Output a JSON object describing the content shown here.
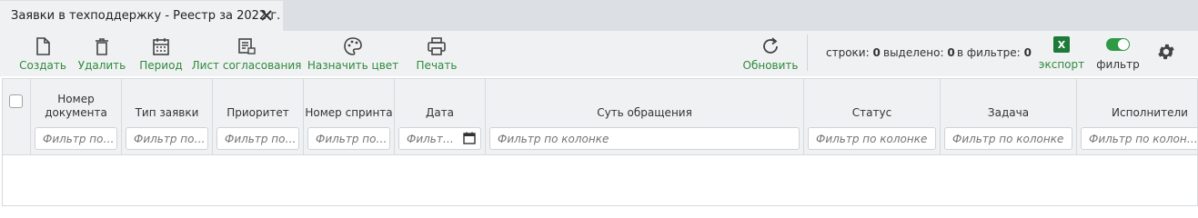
{
  "tab": {
    "title": "Заявки в техподдержку - Реестр за 2022 г.",
    "close_icon": "close-icon"
  },
  "toolbar": {
    "create": "Создать",
    "delete": "Удалить",
    "period": "Период",
    "approval": "Лист согласования",
    "color": "Назначить цвет",
    "print": "Печать",
    "refresh": "Обновить",
    "export": "экспорт",
    "filter": "фильтр",
    "export_icon_letter": "X"
  },
  "stats": {
    "rows_label": "строки:",
    "rows_value": "0",
    "selected_label": "выделено:",
    "selected_value": "0",
    "filtered_label": "в фильтре:",
    "filtered_value": "0"
  },
  "colors": {
    "accent": "#2e8b3c",
    "toggle_on": "#2e9a45",
    "excel": "#1e7a38"
  },
  "columns": [
    {
      "title": "Номер документа",
      "placeholder": "Фильтр по колонке"
    },
    {
      "title": "Тип заявки",
      "placeholder": "Фильтр по колонке"
    },
    {
      "title": "Приоритет",
      "placeholder": "Фильтр по колонке"
    },
    {
      "title": "Номер спринта",
      "placeholder": "Фильтр по колонке"
    },
    {
      "title": "Дата",
      "placeholder": "Фильтр по колонке"
    },
    {
      "title": "Суть обращения",
      "placeholder": "Фильтр по колонке"
    },
    {
      "title": "Статус",
      "placeholder": "Фильтр по колонке"
    },
    {
      "title": "Задача",
      "placeholder": "Фильтр по колонке"
    },
    {
      "title": "Исполнители",
      "placeholder": "Фильтр по колонке"
    }
  ]
}
